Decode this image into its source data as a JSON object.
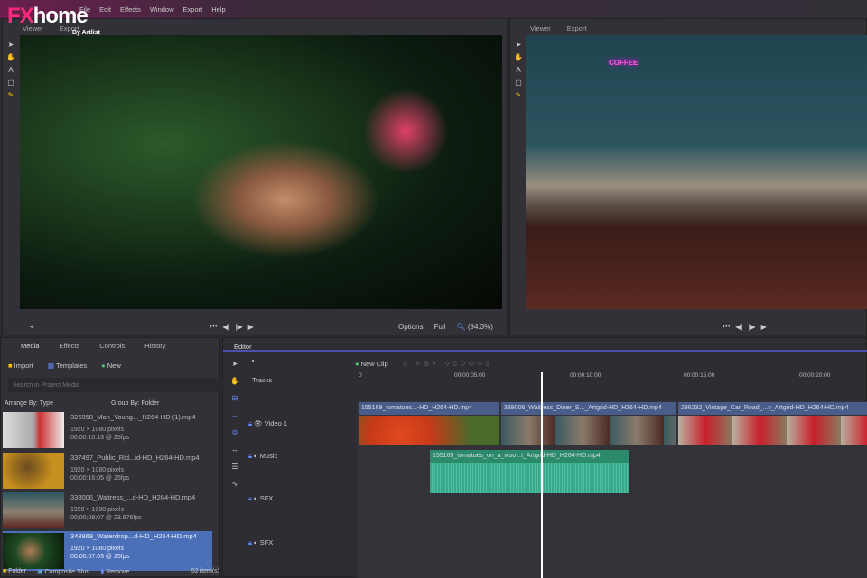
{
  "app": {
    "logo": "FXhome",
    "logo_sub": "By Artlist"
  },
  "menu": [
    "File",
    "Edit",
    "Effects",
    "Window",
    "Export",
    "Help"
  ],
  "viewer_left": {
    "tabs": [
      "Viewer",
      "Export"
    ],
    "options": "Options",
    "full": "Full",
    "zoom": "(94.3%)"
  },
  "viewer_right": {
    "tabs": [
      "Viewer",
      "Export"
    ],
    "sign": "COFFEE"
  },
  "media_panel": {
    "tabs": [
      "Media",
      "Effects",
      "Controls",
      "History"
    ],
    "buttons": {
      "import": "Import",
      "templates": "Templates",
      "new": "New"
    },
    "search_placeholder": "Search in Project Media",
    "arrange": "Arrange By: Type",
    "group": "Group By: Folder",
    "items": [
      {
        "name": "326958_Man_Young..._H264-HD (1).mp4",
        "res": "1920 × 1080 pixels",
        "dur": "00:00:10:13 @ 25fps"
      },
      {
        "name": "337497_Public_Rid...id-HD_H264-HD.mp4",
        "res": "1920 × 1080 pixels",
        "dur": "00:00:16:05 @ 25fps"
      },
      {
        "name": "338006_Waitress_...d-HD_H264-HD.mp4",
        "res": "1920 × 1080 pixels",
        "dur": "00;00;09;07 @ 23.976fps"
      },
      {
        "name": "343869_Waterdrop...d-HD_H264-HD.mp4",
        "res": "1920 × 1080 pixels",
        "dur": "00:00:07:03 @ 25fps"
      }
    ],
    "footer": {
      "folder": "Folder",
      "composite": "Composite Shot",
      "remove": "Remove",
      "count": "52 item(s)"
    }
  },
  "editor": {
    "tab": "Editor",
    "new_clip": "New Clip",
    "tracks_label": "Tracks",
    "ruler": [
      "0",
      "00:00:05:00",
      "00:00:10:00",
      "00:00:15:00",
      "00:00:20:00"
    ],
    "tracks": [
      "Video 1",
      "Music",
      "SFX",
      "SFX"
    ],
    "clips": {
      "video": [
        "155169_tomatoes...-HD_H264-HD.mp4",
        "338006_Waitress_Diner_S..._Artgrid-HD_H264-HD.mp4",
        "286232_Vintage_Car_Road_...y_Artgrid-HD_H264-HD.mp4"
      ],
      "music": "155169_tomatoes_on_a_woo...t_Artgrid-HD_H264-HD.mp4"
    }
  }
}
